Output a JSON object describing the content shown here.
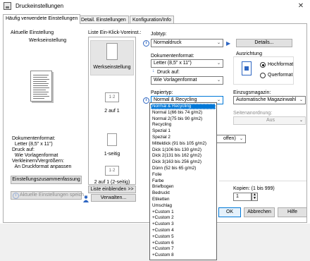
{
  "window": {
    "title": "Druckeinstellungen",
    "close_glyph": "✕"
  },
  "tabs": [
    {
      "label": "Häufig verwendete Einstellungen"
    },
    {
      "label": "Detail. Einstellungen"
    },
    {
      "label": "Konfiguration/Info"
    }
  ],
  "current": {
    "heading": "Aktuelle Einstellung",
    "name": "Werkseinstellung",
    "summary": [
      "Dokumentenformat:",
      "  Letter (8,5\" x 11\")",
      "Druck auf:",
      "  Wie Vorlagenformat",
      "Verkleinern/Vergrößern:",
      "  An Druckformat anpassen"
    ],
    "summary_button": "Einstellungszusammenfassung",
    "save_button": "Aktuelle Einstellungen speich..."
  },
  "presets": {
    "heading": "Liste Ein-Klick-Voreinst.:",
    "items": [
      {
        "label": "Werkseinstellung"
      },
      {
        "label": "2 auf 1",
        "thumb": "1·2"
      },
      {
        "label": "1-seitig"
      },
      {
        "label": "2 auf 1 (2-seitig)",
        "thumb": "1·2"
      }
    ],
    "show_list_button": "Liste einblenden >>",
    "manage_button": "Verwalten..."
  },
  "jobtyp": {
    "label": "Jobtyp:",
    "value": "Normaldruck",
    "details_button": "Details..."
  },
  "docformat": {
    "label": "Dokumentenformat:",
    "value": "Letter (8,5\" x 11\")"
  },
  "druck_auf": {
    "label": "Druck auf:",
    "value": "Wie Vorlagenformat"
  },
  "ausrichtung": {
    "label": "Ausrichtung",
    "options": [
      "Hochformat",
      "Querformat"
    ],
    "selected": "Hochformat"
  },
  "papiertyp": {
    "label": "Papiertyp:",
    "value": "Normal & Recycling",
    "options": [
      "Normal & Recycling",
      "Normal 1(66 bis 74 g/m2)",
      "Normal 2(75 bis 90 g/m2)",
      "Recycling",
      "Spezial 1",
      "Spezial 2",
      "Mitteldick (91 bis 105 g/m2)",
      "Dick 1(106 bis 130 g/m2)",
      "Dick 2(131 bis 162 g/m2)",
      "Dick 3(163 bis 256 g/m2)",
      "Dünn (52 bis 65 g/m2)",
      "Folie",
      "Farbe",
      "Briefbogen",
      "Bedruckt",
      "Etiketten",
      "Umschlag",
      "+Custom 1",
      "+Custom 2",
      "+Custom 3",
      "+Custom 4",
      "+Custom 5",
      "+Custom 6",
      "+Custom 7",
      "+Custom 8"
    ]
  },
  "einzugsmagazin": {
    "label": "Einzugsmagazin:",
    "value": "Automatische Magazinwahl"
  },
  "seitenanordnung": {
    "label": "Seitenanordnung:",
    "value": "Aus"
  },
  "partial_combo": {
    "value": "offen)"
  },
  "kopien": {
    "label": "Kopien: (1 bis 999)",
    "value": "1"
  },
  "footer": {
    "ok": "OK",
    "cancel": "Abbrechen",
    "help": "Hilfe"
  },
  "icons": {
    "info": "i"
  }
}
